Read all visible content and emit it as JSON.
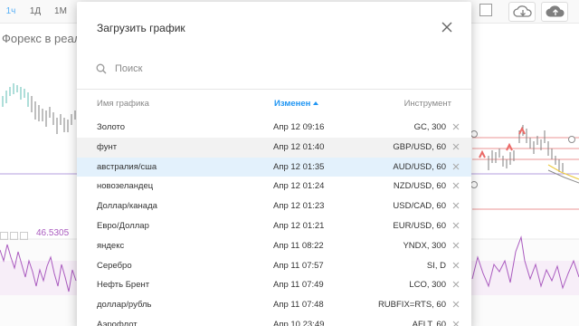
{
  "toolbar": {
    "timeframes": [
      {
        "label": "1ч",
        "active": true
      },
      {
        "label": "1Д",
        "active": false
      },
      {
        "label": "1М",
        "active": false
      }
    ],
    "icons": [
      "cloud-download-icon",
      "cloud-upload-icon"
    ]
  },
  "chart": {
    "title": "Форекс в реал",
    "oscillator_value": "46.5305"
  },
  "modal": {
    "title": "Загрузить график",
    "search_placeholder": "Поиск",
    "search_value": "",
    "columns": {
      "name": "Имя графика",
      "modified": "Изменен",
      "instrument": "Инструмент"
    },
    "sort": {
      "column": "modified",
      "direction": "ascending"
    },
    "rows": [
      {
        "name": "Золото",
        "date": "Апр 12 09:16",
        "symbol": "GC, 300",
        "state": ""
      },
      {
        "name": "фунт",
        "date": "Апр 12 01:40",
        "symbol": "GBP/USD, 60",
        "state": "hover"
      },
      {
        "name": "австралия/сша",
        "date": "Апр 12 01:35",
        "symbol": "AUD/USD, 60",
        "state": "selected"
      },
      {
        "name": "новозеландец",
        "date": "Апр 12 01:24",
        "symbol": "NZD/USD, 60",
        "state": ""
      },
      {
        "name": "Доллар/канада",
        "date": "Апр 12 01:23",
        "symbol": "USD/CAD, 60",
        "state": ""
      },
      {
        "name": "Евро/Доллар",
        "date": "Апр 12 01:21",
        "symbol": "EUR/USD, 60",
        "state": ""
      },
      {
        "name": "яндекс",
        "date": "Апр 11 08:22",
        "symbol": "YNDX, 300",
        "state": ""
      },
      {
        "name": "Серебро",
        "date": "Апр 11 07:57",
        "symbol": "SI, D",
        "state": ""
      },
      {
        "name": "Нефть Брент",
        "date": "Апр 11 07:49",
        "symbol": "LCO, 300",
        "state": ""
      },
      {
        "name": "доллар/рубль",
        "date": "Апр 11 07:48",
        "symbol": "RUBFIX=RTS, 60",
        "state": ""
      },
      {
        "name": "Аэрофлот",
        "date": "Апр 10 23:49",
        "symbol": "AFLT, 60",
        "state": ""
      }
    ]
  },
  "colors": {
    "accent": "#2196f3",
    "selected_row": "#e3f1fc",
    "hover_row": "#f2f2f2",
    "oscillator": "#8e24aa"
  }
}
